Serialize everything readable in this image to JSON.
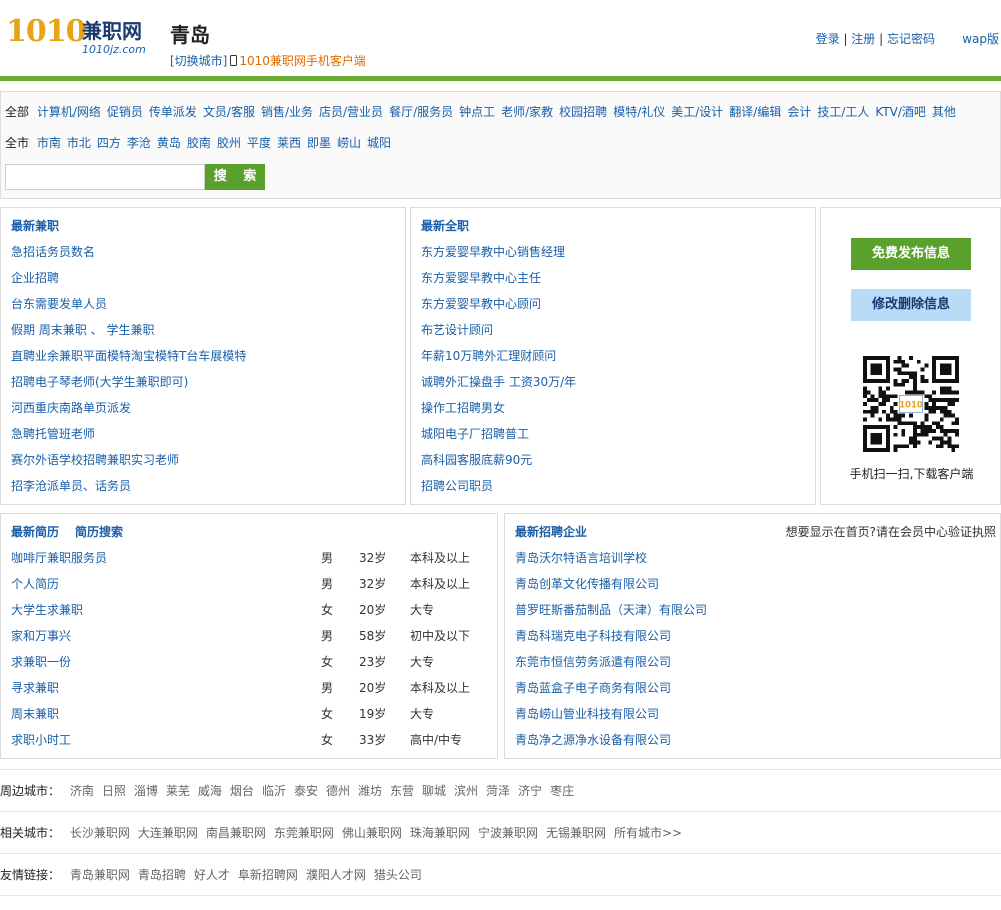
{
  "header": {
    "logo_number": "1010",
    "logo_name": "兼职网",
    "logo_domain": "1010jz.com",
    "city": "青岛",
    "switch_city": "[切换城市]",
    "app_link": "1010兼职网手机客户端",
    "login": "登录",
    "register": "注册",
    "forgot": "忘记密码",
    "sep": " | ",
    "wap": "wap版"
  },
  "filter": {
    "category_all": "全部",
    "categories": [
      "计算机/网络",
      "促销员",
      "传单派发",
      "文员/客服",
      "销售/业务",
      "店员/营业员",
      "餐厅/服务员",
      "钟点工",
      "老师/家教",
      "校园招聘",
      "模特/礼仪",
      "美工/设计",
      "翻译/编辑",
      "会计",
      "技工/工人",
      "KTV/酒吧",
      "其他"
    ],
    "district_all": "全市",
    "districts": [
      "市南",
      "市北",
      "四方",
      "李沧",
      "黄岛",
      "胶南",
      "胶州",
      "平度",
      "莱西",
      "即墨",
      "崂山",
      "城阳"
    ],
    "search_value": "",
    "search_button": "搜 索"
  },
  "parttime": {
    "title": "最新兼职",
    "items": [
      "急招话务员数名",
      "企业招聘",
      "台东需要发单人员",
      "假期 周末兼职 、 学生兼职",
      "直聘业余兼职平面模特淘宝模特T台车展模特",
      "招聘电子琴老师(大学生兼职即可)",
      "河西重庆南路单页派发",
      "急聘托管班老师",
      "赛尔外语学校招聘兼职实习老师",
      "招李沧派单员、话务员"
    ]
  },
  "fulltime": {
    "title": "最新全职",
    "items": [
      "东方爱婴早教中心销售经理",
      "东方爱婴早教中心主任",
      "东方爱婴早教中心顾问",
      "布艺设计顾问",
      "年薪10万聘外汇理财顾问",
      "诚聘外汇操盘手 工资30万/年",
      "操作工招聘男女",
      "城阳电子厂招聘普工",
      "高科园客服底薪90元",
      "招聘公司职员"
    ]
  },
  "side": {
    "publish": "免费发布信息",
    "edit": "修改删除信息",
    "qr_caption": "手机扫一扫,下载客户端",
    "qr_badge": "1010",
    "accent": "#5aa02c"
  },
  "resumes": {
    "title": "最新简历",
    "search_title": "简历搜索",
    "rows": [
      {
        "name": "咖啡厅兼职服务员",
        "gender": "男",
        "age": "32岁",
        "edu": "本科及以上"
      },
      {
        "name": "个人简历",
        "gender": "男",
        "age": "32岁",
        "edu": "本科及以上"
      },
      {
        "name": "大学生求兼职",
        "gender": "女",
        "age": "20岁",
        "edu": "大专"
      },
      {
        "name": "家和万事兴",
        "gender": "男",
        "age": "58岁",
        "edu": "初中及以下"
      },
      {
        "name": "求兼职一份",
        "gender": "女",
        "age": "23岁",
        "edu": "大专"
      },
      {
        "name": "寻求兼职",
        "gender": "男",
        "age": "20岁",
        "edu": "本科及以上"
      },
      {
        "name": "周末兼职",
        "gender": "女",
        "age": "19岁",
        "edu": "大专"
      },
      {
        "name": "求职小时工",
        "gender": "女",
        "age": "33岁",
        "edu": "高中/中专"
      }
    ]
  },
  "companies": {
    "title": "最新招聘企业",
    "promo": "想要显示在首页?请在会员中心验证执照",
    "items": [
      "青岛沃尔特语言培训学校",
      "青岛创革文化传播有限公司",
      "普罗旺斯番茄制品（天津）有限公司",
      "青岛科瑞克电子科技有限公司",
      "东莞市恒信劳务派遣有限公司",
      "青岛蓝盒子电子商务有限公司",
      "青岛崂山管业科技有限公司",
      "青岛净之源净水设备有限公司"
    ]
  },
  "footer": {
    "nearby_label": "周边城市：",
    "nearby": [
      "济南",
      "日照",
      "淄博",
      "莱芜",
      "威海",
      "烟台",
      "临沂",
      "泰安",
      "德州",
      "潍坊",
      "东营",
      "聊城",
      "滨州",
      "菏泽",
      "济宁",
      "枣庄"
    ],
    "related_label": "相关城市：",
    "related": [
      "长沙兼职网",
      "大连兼职网",
      "南昌兼职网",
      "东莞兼职网",
      "佛山兼职网",
      "珠海兼职网",
      "宁波兼职网",
      "无锡兼职网",
      "所有城市>>"
    ],
    "friends_label": "友情链接：",
    "friends": [
      "青岛兼职网",
      "青岛招聘",
      "好人才",
      "阜新招聘网",
      "濮阳人才网",
      "猎头公司"
    ]
  }
}
